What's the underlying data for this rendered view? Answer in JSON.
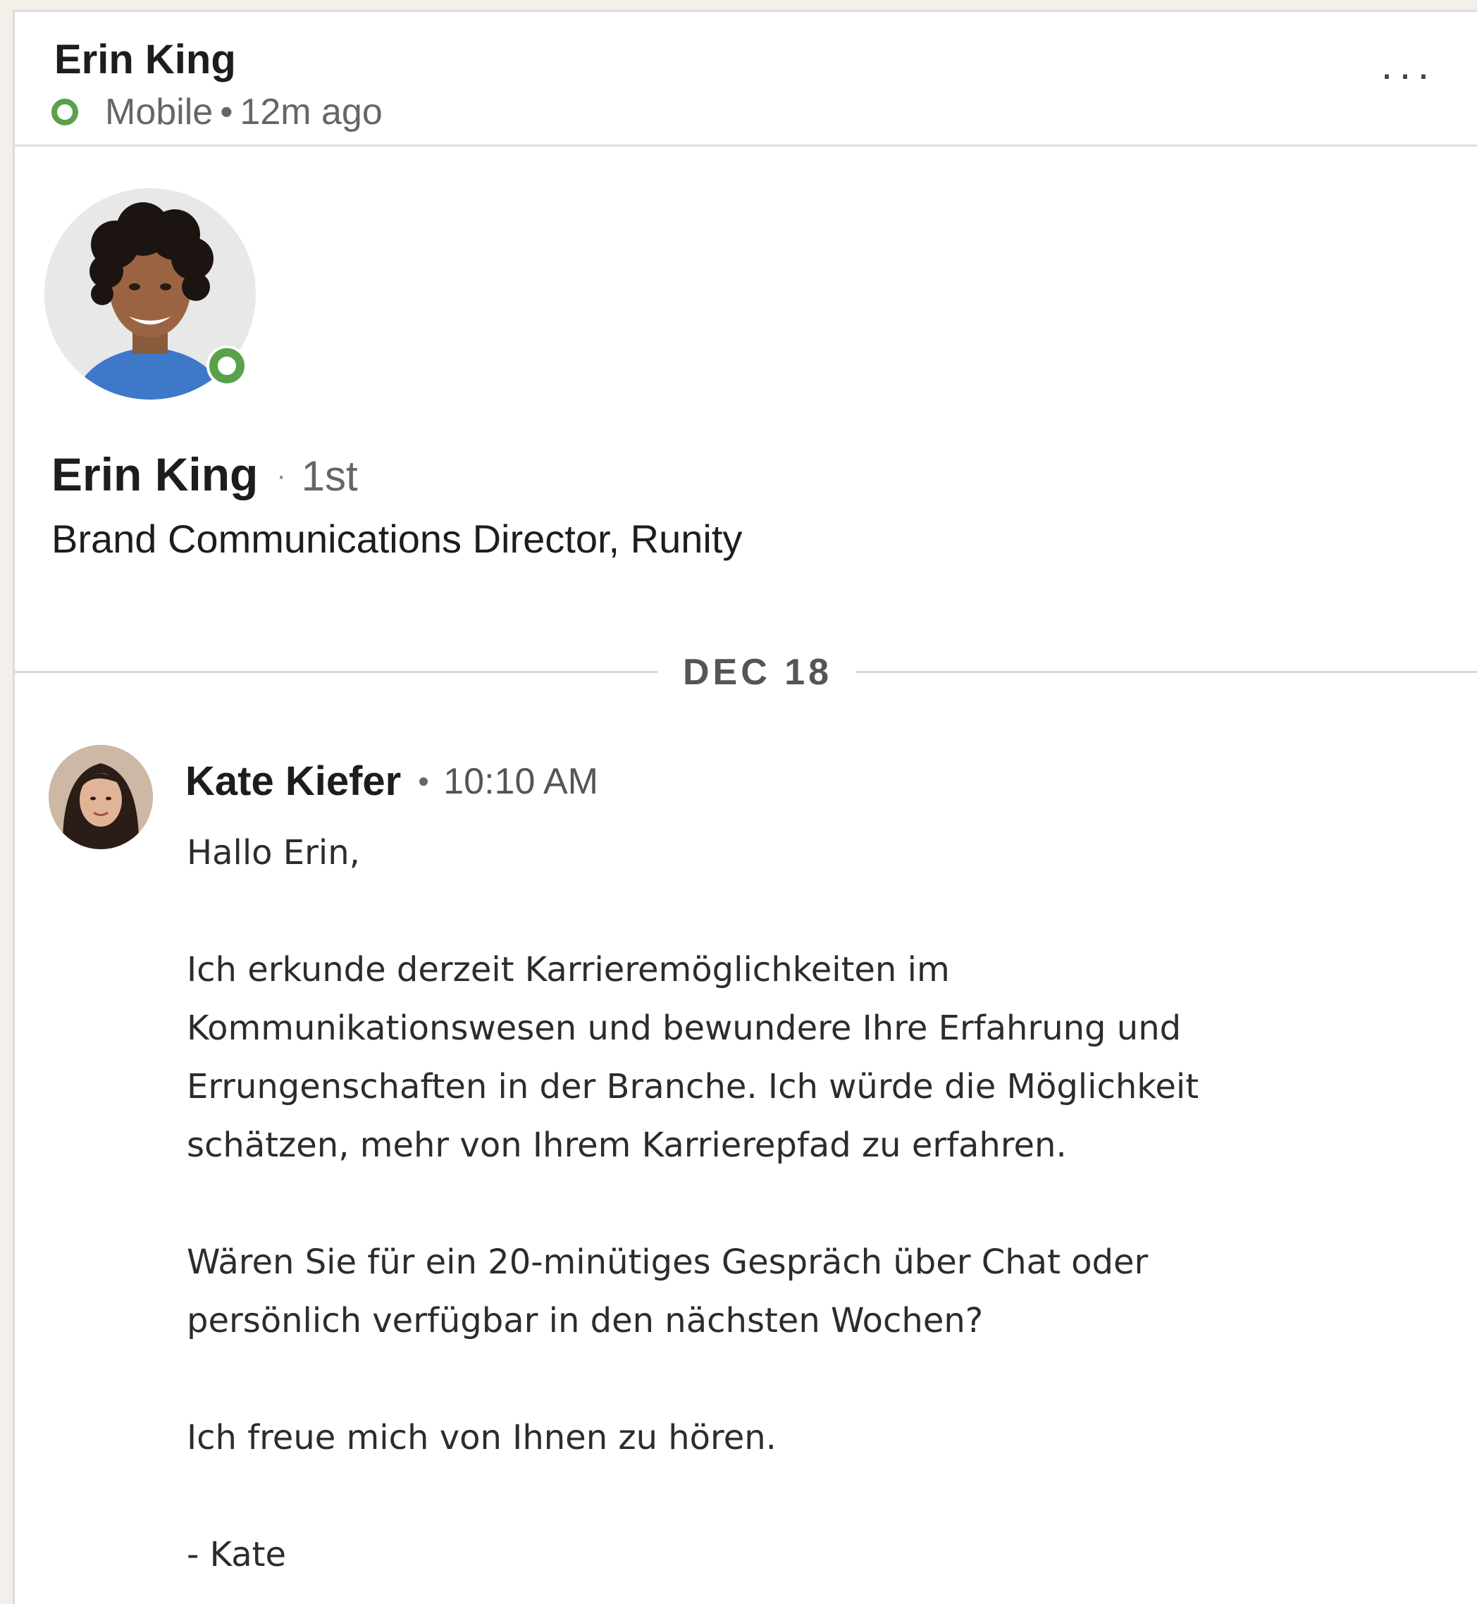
{
  "header": {
    "name": "Erin King",
    "device": "Mobile",
    "separator": "•",
    "last_active": "12m ago",
    "more_icon": "more-horizontal-icon"
  },
  "profile": {
    "name": "Erin King",
    "degree_separator": "·",
    "degree": "1st",
    "headline": "Brand Communications Director, Runity",
    "presence": "online"
  },
  "conversation": {
    "date": "DEC 18",
    "message": {
      "sender": "Kate Kiefer",
      "time": "10:10 AM",
      "lines": [
        "Hallo Erin,",
        "",
        "Ich erkunde derzeit Karrieremöglichkeiten im",
        "Kommunikationswesen und bewundere Ihre Erfahrung und",
        "Errungenschaften in der Branche. Ich würde die Möglichkeit",
        "schätzen, mehr von Ihrem Karrierepfad zu erfahren.",
        "",
        "Wären Sie für ein 20-minütiges Gespräch über Chat oder",
        "persönlich verfügbar in den nächsten Wochen?",
        "",
        "Ich freue mich von Ihnen zu hören.",
        "",
        "- Kate"
      ]
    }
  },
  "colors": {
    "presence_green": "#5aa14b",
    "background": "#f3efe9",
    "divider": "#dadada"
  }
}
